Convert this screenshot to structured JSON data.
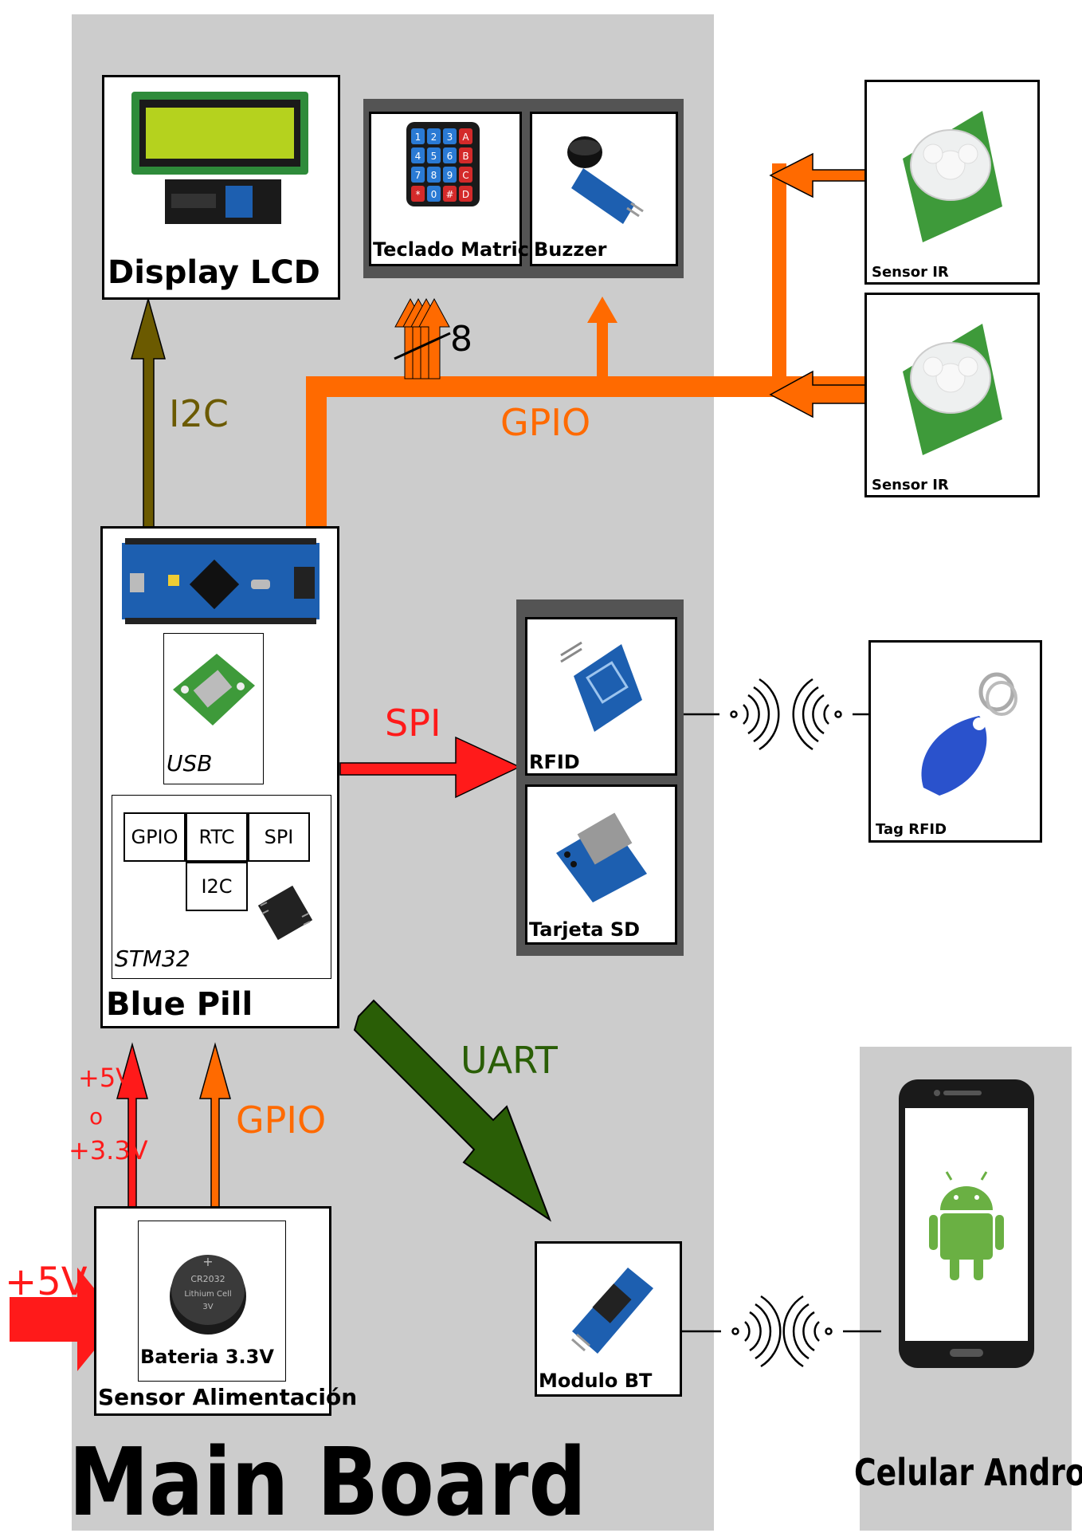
{
  "main_board": {
    "title": "Main Board"
  },
  "display_lcd": {
    "label": "Display LCD",
    "icon": "lcd-module-icon"
  },
  "keypad": {
    "label": "Teclado Matricial",
    "icon": "keypad-icon",
    "keys": [
      "1",
      "2",
      "3",
      "A",
      "4",
      "5",
      "6",
      "B",
      "7",
      "8",
      "9",
      "C",
      "*",
      "0",
      "#",
      "D"
    ]
  },
  "buzzer": {
    "label": "Buzzer",
    "icon": "buzzer-icon"
  },
  "sensor_ir_1": {
    "label": "Sensor IR",
    "icon": "pir-sensor-icon"
  },
  "sensor_ir_2": {
    "label": "Sensor IR",
    "icon": "pir-sensor-icon"
  },
  "blue_pill": {
    "label": "Blue Pill",
    "usb_label": "USB",
    "stm32_label": "STM32",
    "peripherals": [
      "GPIO",
      "RTC",
      "SPI",
      "I2C"
    ],
    "icon": "microcontroller-board-icon"
  },
  "rfid": {
    "label": "RFID",
    "icon": "rfid-reader-icon"
  },
  "sd_card": {
    "label": "Tarjeta SD",
    "icon": "sd-card-module-icon"
  },
  "tag_rfid": {
    "label": "Tag RFID",
    "icon": "rfid-tag-icon"
  },
  "power": {
    "label": "Sensor Alimentación",
    "battery_label": "Bateria 3.3V",
    "coin_cell_text": [
      "CR2032",
      "Lithium Cell",
      "3V"
    ],
    "input_label": "+5V"
  },
  "bluetooth": {
    "label": "Modulo BT",
    "icon": "bluetooth-module-icon"
  },
  "phone": {
    "label": "Celular Android",
    "icon": "android-icon"
  },
  "signals": {
    "i2c": "I2C",
    "gpio_bus": "GPIO",
    "bus_width": "8",
    "spi": "SPI",
    "uart": "UART",
    "gpio_power": "GPIO",
    "supply_line1": "+5V",
    "supply_line2": "o",
    "supply_line3": "+3.3V"
  },
  "colors": {
    "orange": "#ff6a00",
    "red": "#ff1a1a",
    "olive": "#6b5a00",
    "green": "#2a5e06",
    "board_gray": "#cccccc",
    "dark_gray": "#545454"
  }
}
